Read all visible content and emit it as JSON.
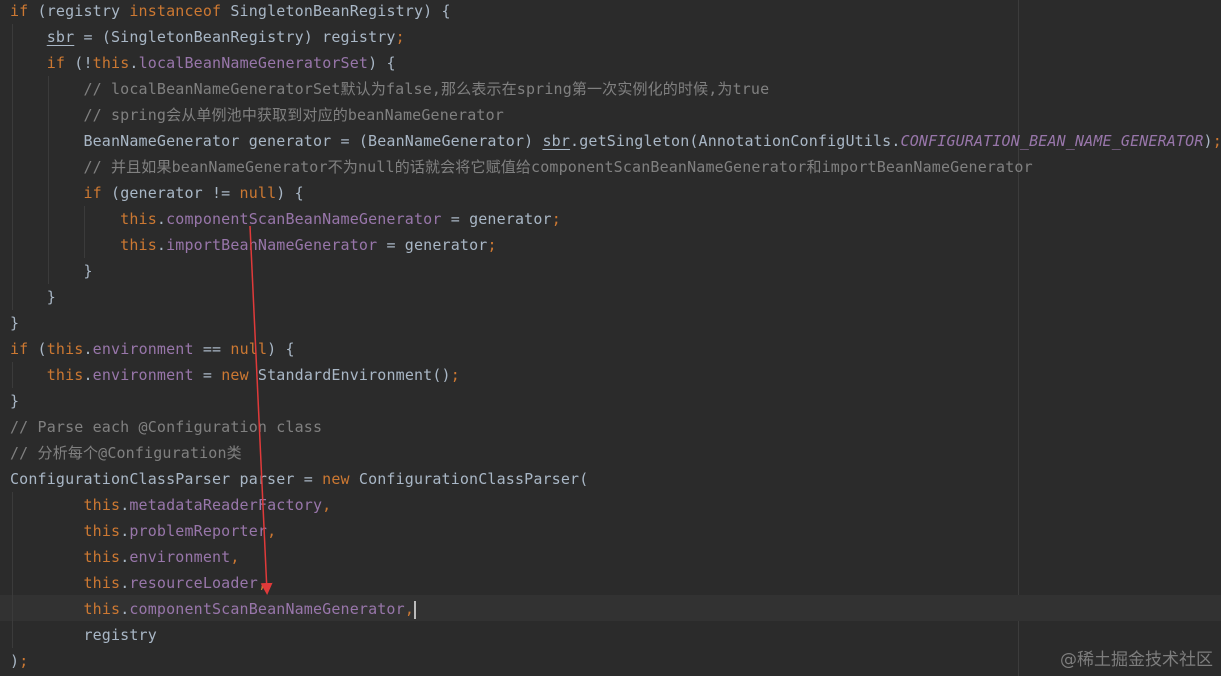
{
  "lines": [
    {
      "parts": [
        {
          "t": "if",
          "c": "kw"
        },
        {
          "t": " (registry "
        },
        {
          "t": "instanceof",
          "c": "kw"
        },
        {
          "t": " SingletonBeanRegistry) {"
        }
      ]
    },
    {
      "parts": [
        {
          "t": "    "
        },
        {
          "t": "sbr",
          "c": "under"
        },
        {
          "t": " = (SingletonBeanRegistry) registry"
        },
        {
          "t": ";",
          "c": "semi"
        }
      ]
    },
    {
      "parts": [
        {
          "t": "    "
        },
        {
          "t": "if",
          "c": "kw"
        },
        {
          "t": " (!"
        },
        {
          "t": "this",
          "c": "kw"
        },
        {
          "t": "."
        },
        {
          "t": "localBeanNameGeneratorSet",
          "c": "fld"
        },
        {
          "t": ") {"
        }
      ]
    },
    {
      "parts": [
        {
          "t": "        "
        },
        {
          "t": "// localBeanNameGeneratorSet默认为false,那么表示在spring第一次实例化的时候,为true",
          "c": "cm"
        }
      ]
    },
    {
      "parts": [
        {
          "t": "        "
        },
        {
          "t": "// spring会从单例池中获取到对应的beanNameGenerator",
          "c": "cm"
        }
      ]
    },
    {
      "parts": [
        {
          "t": "        BeanNameGenerator generator = (BeanNameGenerator) "
        },
        {
          "t": "sbr",
          "c": "under"
        },
        {
          "t": ".getSingleton(AnnotationConfigUtils."
        },
        {
          "t": "CONFIGURATION_BEAN_NAME_GENERATOR",
          "c": "const"
        },
        {
          "t": ")"
        },
        {
          "t": ";",
          "c": "semi"
        }
      ]
    },
    {
      "parts": [
        {
          "t": "        "
        },
        {
          "t": "// 并且如果beanNameGenerator不为null的话就会将它赋值给componentScanBeanNameGenerator和importBeanNameGenerator",
          "c": "cm"
        }
      ]
    },
    {
      "parts": [
        {
          "t": "        "
        },
        {
          "t": "if",
          "c": "kw"
        },
        {
          "t": " (generator != "
        },
        {
          "t": "null",
          "c": "kw"
        },
        {
          "t": ") {"
        }
      ]
    },
    {
      "parts": [
        {
          "t": "            "
        },
        {
          "t": "this",
          "c": "kw"
        },
        {
          "t": "."
        },
        {
          "t": "componentScanBeanNameGenerator",
          "c": "fld"
        },
        {
          "t": " = generator"
        },
        {
          "t": ";",
          "c": "semi"
        }
      ]
    },
    {
      "parts": [
        {
          "t": "            "
        },
        {
          "t": "this",
          "c": "kw"
        },
        {
          "t": "."
        },
        {
          "t": "importBeanNameGenerator",
          "c": "fld"
        },
        {
          "t": " = generator"
        },
        {
          "t": ";",
          "c": "semi"
        }
      ]
    },
    {
      "parts": [
        {
          "t": "        }"
        }
      ]
    },
    {
      "parts": [
        {
          "t": "    }"
        }
      ]
    },
    {
      "parts": [
        {
          "t": "}"
        }
      ]
    },
    {
      "parts": [
        {
          "t": "if",
          "c": "kw"
        },
        {
          "t": " ("
        },
        {
          "t": "this",
          "c": "kw"
        },
        {
          "t": "."
        },
        {
          "t": "environment",
          "c": "fld"
        },
        {
          "t": " == "
        },
        {
          "t": "null",
          "c": "kw"
        },
        {
          "t": ") {"
        }
      ]
    },
    {
      "parts": [
        {
          "t": "    "
        },
        {
          "t": "this",
          "c": "kw"
        },
        {
          "t": "."
        },
        {
          "t": "environment",
          "c": "fld"
        },
        {
          "t": " = "
        },
        {
          "t": "new",
          "c": "kw"
        },
        {
          "t": " StandardEnvironment()"
        },
        {
          "t": ";",
          "c": "semi"
        }
      ]
    },
    {
      "parts": [
        {
          "t": "}"
        }
      ]
    },
    {
      "parts": [
        {
          "t": "// Parse each @Configuration class",
          "c": "cm"
        }
      ]
    },
    {
      "parts": [
        {
          "t": "// 分析每个@Configuration类",
          "c": "cm"
        }
      ]
    },
    {
      "parts": [
        {
          "t": "ConfigurationClassParser parser = "
        },
        {
          "t": "new",
          "c": "kw"
        },
        {
          "t": " ConfigurationClassParser("
        }
      ]
    },
    {
      "parts": [
        {
          "t": "        "
        },
        {
          "t": "this",
          "c": "kw"
        },
        {
          "t": "."
        },
        {
          "t": "metadataReaderFactory",
          "c": "fld"
        },
        {
          "t": ",",
          "c": "semi"
        }
      ]
    },
    {
      "parts": [
        {
          "t": "        "
        },
        {
          "t": "this",
          "c": "kw"
        },
        {
          "t": "."
        },
        {
          "t": "problemReporter",
          "c": "fld"
        },
        {
          "t": ",",
          "c": "semi"
        }
      ]
    },
    {
      "parts": [
        {
          "t": "        "
        },
        {
          "t": "this",
          "c": "kw"
        },
        {
          "t": "."
        },
        {
          "t": "environment",
          "c": "fld"
        },
        {
          "t": ",",
          "c": "semi"
        }
      ]
    },
    {
      "parts": [
        {
          "t": "        "
        },
        {
          "t": "this",
          "c": "kw"
        },
        {
          "t": "."
        },
        {
          "t": "resourceLoader",
          "c": "fld"
        },
        {
          "t": ",",
          "c": "semi"
        }
      ]
    },
    {
      "parts": [
        {
          "t": "        "
        },
        {
          "t": "this",
          "c": "kw"
        },
        {
          "t": "."
        },
        {
          "t": "componentScanBeanNameGenerator",
          "c": "fld"
        },
        {
          "t": ",",
          "c": "semi"
        },
        {
          "t": "",
          "c": "caret"
        }
      ]
    },
    {
      "parts": [
        {
          "t": "        registry"
        }
      ]
    },
    {
      "parts": [
        {
          "t": ")"
        },
        {
          "t": ";",
          "c": "semi"
        }
      ]
    }
  ],
  "watermark": "@稀土掘金技术社区",
  "colors": {
    "background": "#2b2b2b",
    "keyword": "#cc7832",
    "field": "#9876aa",
    "comment": "#808080",
    "text": "#a9b7c6",
    "arrow": "#e03a3a"
  }
}
